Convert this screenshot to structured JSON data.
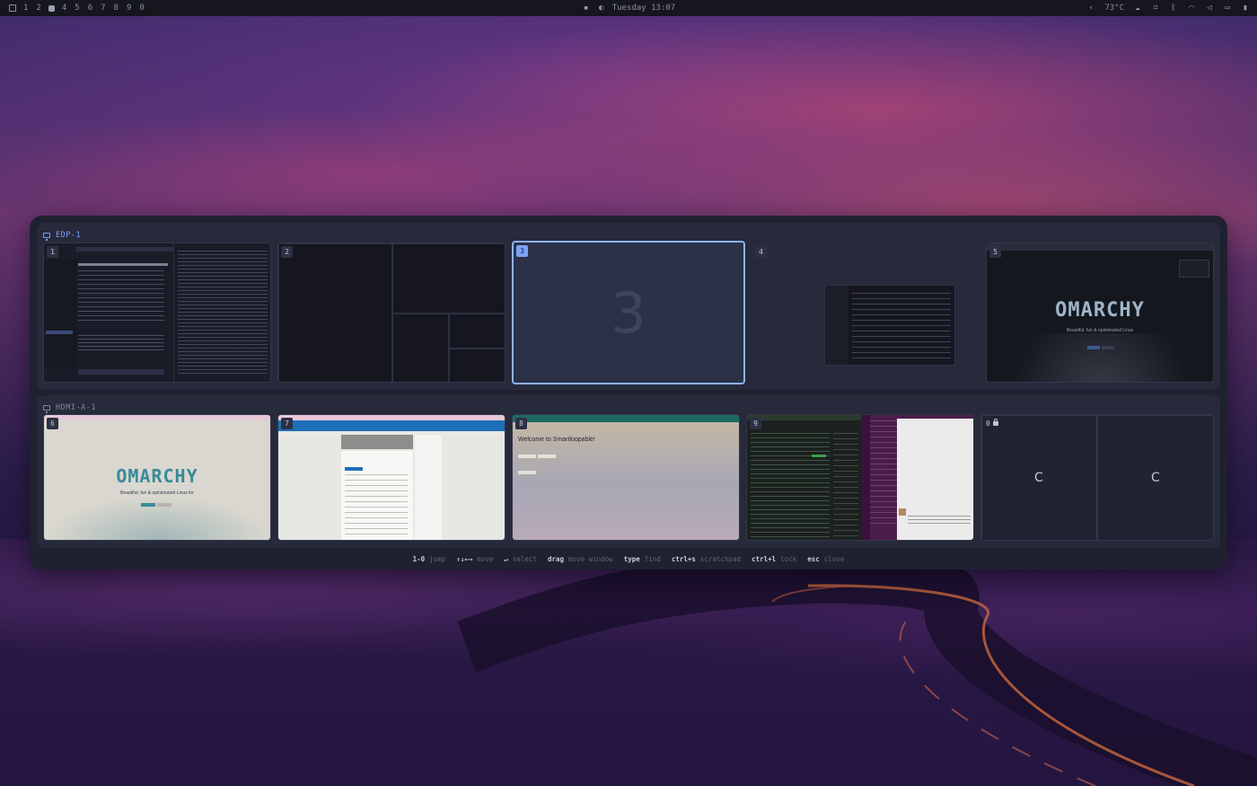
{
  "topbar": {
    "workspaces": [
      "1",
      "2",
      "4",
      "5",
      "6",
      "7",
      "8",
      "9",
      "0"
    ],
    "clock": "Tuesday 13:07",
    "weather": "73°C"
  },
  "monitors": [
    {
      "name": "EDP-1",
      "workspaces": [
        {
          "number": "1"
        },
        {
          "number": "2"
        },
        {
          "number": "3",
          "placeholder": "3",
          "selected": true
        },
        {
          "number": "4"
        },
        {
          "number": "5",
          "logo": "OMARCHY",
          "tagline": "Beautiful, fun & opinionated Linux"
        }
      ]
    },
    {
      "name": "HDMI-A-1",
      "workspaces": [
        {
          "number": "6",
          "logo": "OMARCHY",
          "tagline": "Beautiful, fun & opinionated Linux for"
        },
        {
          "number": "7"
        },
        {
          "number": "8",
          "heading": "Welcome to Smartloopable!"
        },
        {
          "number": "9"
        },
        {
          "number": "0",
          "locked": true,
          "letters": [
            "C",
            "C"
          ]
        }
      ]
    }
  ],
  "hints": [
    {
      "key": "1-0",
      "desc": "jump"
    },
    {
      "key": "↑↓←→",
      "desc": "move"
    },
    {
      "key": "↵",
      "desc": "select"
    },
    {
      "key": "drag",
      "desc": "move window"
    },
    {
      "key": "type",
      "desc": "find"
    },
    {
      "key": "ctrl+s",
      "desc": "scratchpad"
    },
    {
      "key": "ctrl+l",
      "desc": "lock"
    },
    {
      "key": "esc",
      "desc": "close"
    }
  ],
  "colors": {
    "accent": "#7aa2f7",
    "panel": "#1f2130",
    "selected_border": "#8fb2ff"
  }
}
